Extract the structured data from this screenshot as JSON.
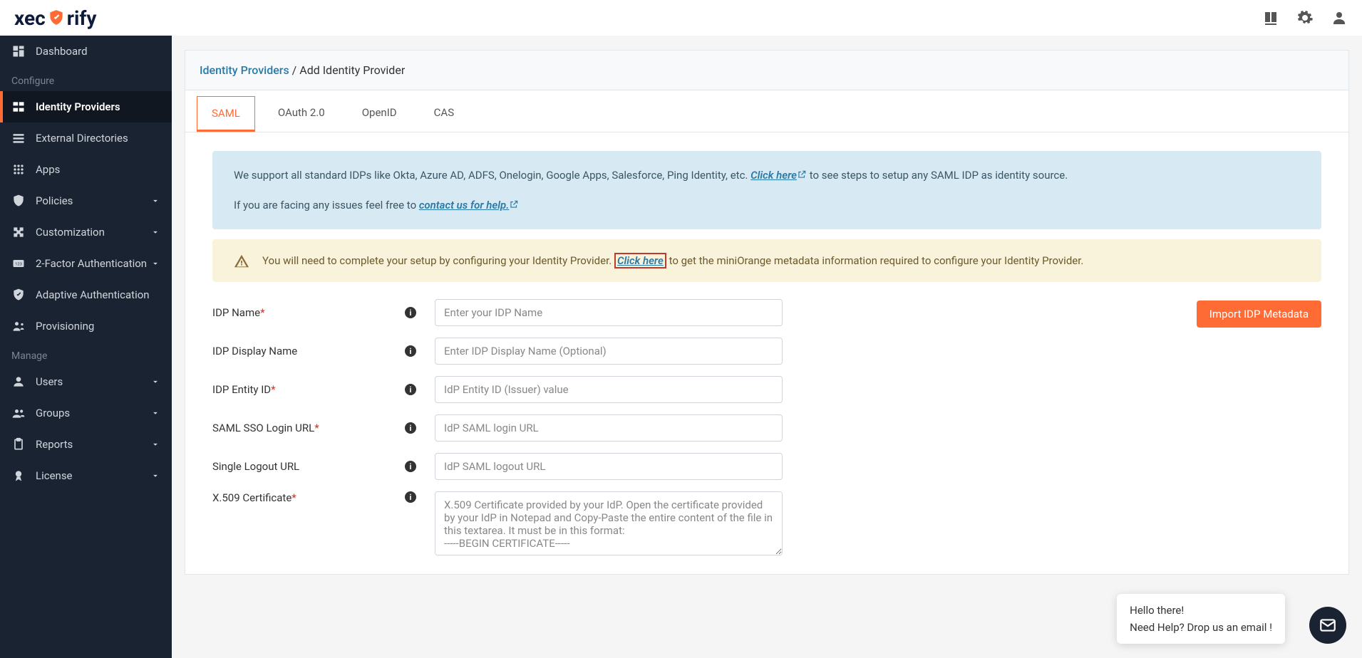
{
  "logo": {
    "text_pre": "xec",
    "text_post": "rify"
  },
  "topbar_icons": [
    "book-icon",
    "gear-icon",
    "person-icon"
  ],
  "sidebar": {
    "items": [
      {
        "label": "Dashboard",
        "icon": "dashboard-icon",
        "expandable": false
      },
      {
        "section": "Configure"
      },
      {
        "label": "Identity Providers",
        "icon": "idp-icon",
        "active": true,
        "expandable": false
      },
      {
        "label": "External Directories",
        "icon": "list-icon",
        "expandable": false
      },
      {
        "label": "Apps",
        "icon": "apps-icon",
        "expandable": false
      },
      {
        "label": "Policies",
        "icon": "shield-icon",
        "expandable": true
      },
      {
        "label": "Customization",
        "icon": "puzzle-icon",
        "expandable": true
      },
      {
        "label": "2-Factor Authentication",
        "icon": "2fa-icon",
        "expandable": true
      },
      {
        "label": "Adaptive Authentication",
        "icon": "check-shield-icon",
        "expandable": false
      },
      {
        "label": "Provisioning",
        "icon": "provision-icon",
        "expandable": false
      },
      {
        "section": "Manage"
      },
      {
        "label": "Users",
        "icon": "user-icon",
        "expandable": true
      },
      {
        "label": "Groups",
        "icon": "group-icon",
        "expandable": true
      },
      {
        "label": "Reports",
        "icon": "clipboard-icon",
        "expandable": true
      },
      {
        "label": "License",
        "icon": "badge-icon",
        "expandable": true
      }
    ]
  },
  "breadcrumb": {
    "link": "Identity Providers",
    "sep": " / ",
    "current": "Add Identity Provider"
  },
  "tabs": [
    "SAML",
    "OAuth 2.0",
    "OpenID",
    "CAS"
  ],
  "active_tab": 0,
  "info_alert": {
    "p1_pre": "We support all standard IDPs like Okta, Azure AD, ADFS, Onelogin, Google Apps, Salesforce, Ping Identity, etc. ",
    "p1_link": "Click here",
    "p1_post": " to see steps to setup any SAML IDP as identity source.",
    "p2_pre": "If you are facing any issues feel free to ",
    "p2_link": "contact us for help."
  },
  "warn_alert": {
    "pre": "You will need to complete your setup by configuring your Identity Provider. ",
    "link": "Click here",
    "post": " to get the miniOrange metadata information required to configure your Identity Provider."
  },
  "import_btn": "Import IDP Metadata",
  "fields": [
    {
      "label": "IDP Name",
      "required": true,
      "placeholder": "Enter your IDP Name",
      "type": "text"
    },
    {
      "label": "IDP Display Name",
      "required": false,
      "placeholder": "Enter IDP Display Name (Optional)",
      "type": "text"
    },
    {
      "label": "IDP Entity ID",
      "required": true,
      "placeholder": "IdP Entity ID (Issuer) value",
      "type": "text"
    },
    {
      "label": "SAML SSO Login URL",
      "required": true,
      "placeholder": "IdP SAML login URL",
      "type": "text"
    },
    {
      "label": "Single Logout URL",
      "required": false,
      "placeholder": "IdP SAML logout URL",
      "type": "text"
    },
    {
      "label": "X.509 Certificate",
      "required": true,
      "placeholder": "X.509 Certificate provided by your IdP. Open the certificate provided by your IdP in Notepad and Copy-Paste the entire content of the file in this textarea. It must be in this format:\n-----BEGIN CERTIFICATE-----",
      "type": "textarea"
    }
  ],
  "chat": {
    "line1": "Hello there!",
    "line2": "Need Help? Drop us an email !"
  }
}
